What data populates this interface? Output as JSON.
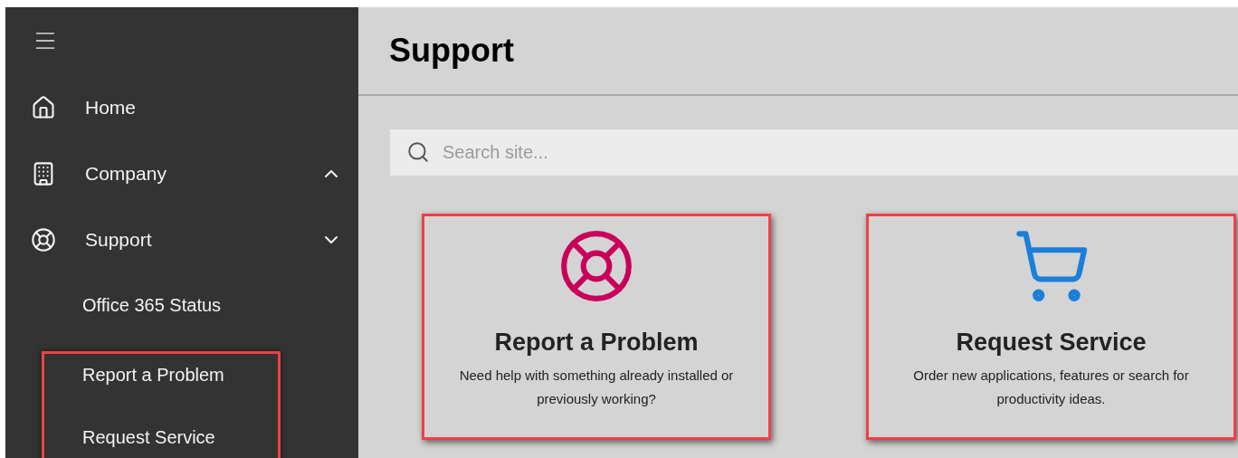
{
  "sidebar": {
    "items": [
      {
        "label": "Home",
        "kind": "home"
      },
      {
        "label": "Company",
        "kind": "building",
        "expanded": false
      },
      {
        "label": "Support",
        "kind": "lifebuoy",
        "expanded": true,
        "children": [
          {
            "label": "Office 365 Status",
            "highlighted": false
          },
          {
            "label": "Report a Problem",
            "highlighted": true
          },
          {
            "label": "Request Service",
            "highlighted": true
          }
        ]
      }
    ]
  },
  "header": {
    "title": "Support"
  },
  "search": {
    "placeholder": "Search site..."
  },
  "cards": [
    {
      "title": "Report a Problem",
      "description": "Need help with something already installed or previously working?",
      "kind": "lifebuoy",
      "color": "#c8005a",
      "highlighted": true
    },
    {
      "title": "Request Service",
      "description": "Order new applications, features or search for productivity ideas.",
      "kind": "cart",
      "color": "#1a7fd9",
      "highlighted": true
    }
  ]
}
